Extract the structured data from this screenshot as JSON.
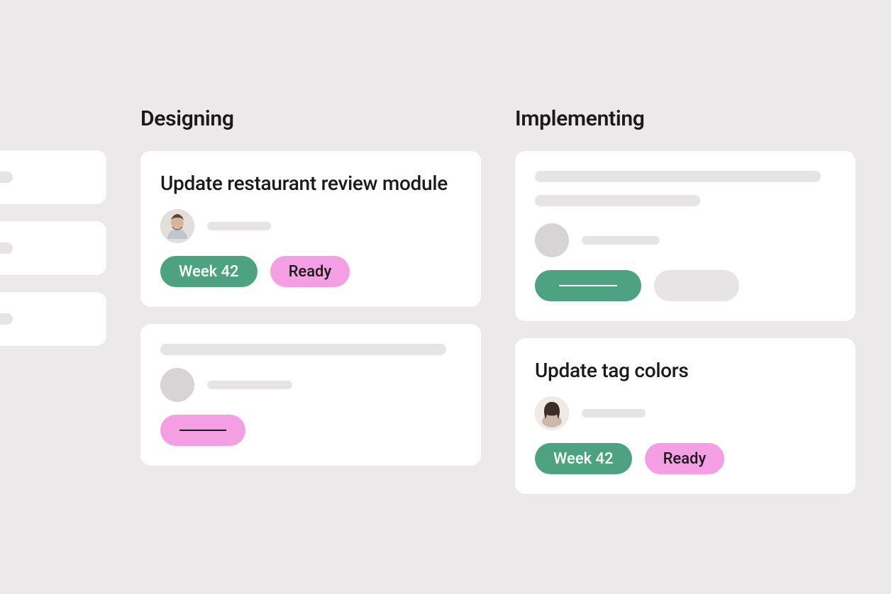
{
  "columns": {
    "designing": {
      "title": "Designing",
      "cards": [
        {
          "title": "Update restaurant review module",
          "week_tag": "Week 42",
          "status_tag": "Ready"
        }
      ]
    },
    "implementing": {
      "title": "Implementing",
      "cards": [
        {
          "title": "Update tag colors",
          "week_tag": "Week 42",
          "status_tag": "Ready"
        }
      ]
    }
  },
  "colors": {
    "week_tag_bg": "#4da381",
    "status_tag_bg": "#f49ee4",
    "card_bg": "#ffffff",
    "page_bg": "#ebe9ea"
  }
}
